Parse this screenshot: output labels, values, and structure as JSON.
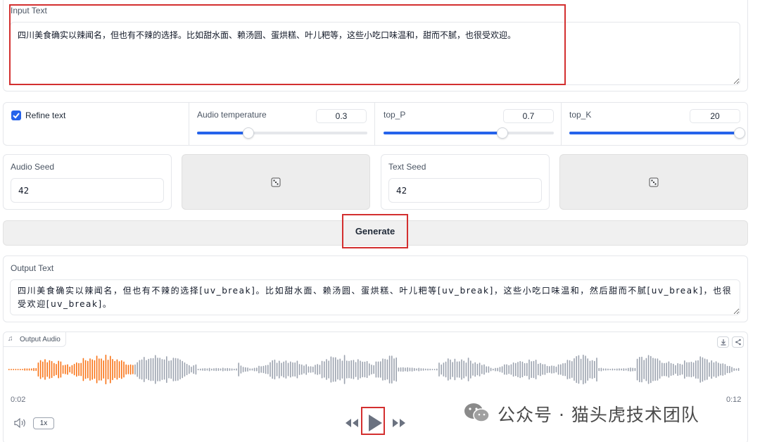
{
  "input": {
    "label": "Input Text",
    "value": "四川美食确实以辣闻名，但也有不辣的选择。比如甜水面、赖汤圆、蛋烘糕、叶儿粑等，这些小吃口味温和，甜而不腻，也很受欢迎。"
  },
  "settings": {
    "refine_label": "Refine text",
    "refine_checked": true,
    "audio_temperature": {
      "label": "Audio temperature",
      "value": "0.3",
      "level": 0.3
    },
    "top_p": {
      "label": "top_P",
      "value": "0.7",
      "level": 0.7
    },
    "top_k": {
      "label": "top_K",
      "value": "20",
      "level": 1.0
    }
  },
  "seeds": {
    "audio_label": "Audio Seed",
    "audio_value": "42",
    "text_label": "Text Seed",
    "text_value": "42",
    "dice_icon": "dice-icon"
  },
  "generate_label": "Generate",
  "output": {
    "label": "Output Text",
    "value": "四川美食确实以辣闻名，但也有不辣的选择[uv_break]。比如甜水面、赖汤圆、蛋烘糕、叶儿粑等[uv_break]，这些小吃口味温和，然后甜而不腻[uv_break]，也很受欢迎[uv_break]。"
  },
  "audio": {
    "label": "Output Audio",
    "time_current": "0:02",
    "time_total": "0:12",
    "speed": "1x",
    "progress": 0.17,
    "played_color": "#f97316",
    "unplayed_color": "#9ca3af"
  },
  "watermark": "公众号 · 猫头虎技术团队",
  "colors": {
    "accent": "#2563eb",
    "highlight": "#d32f2f"
  }
}
